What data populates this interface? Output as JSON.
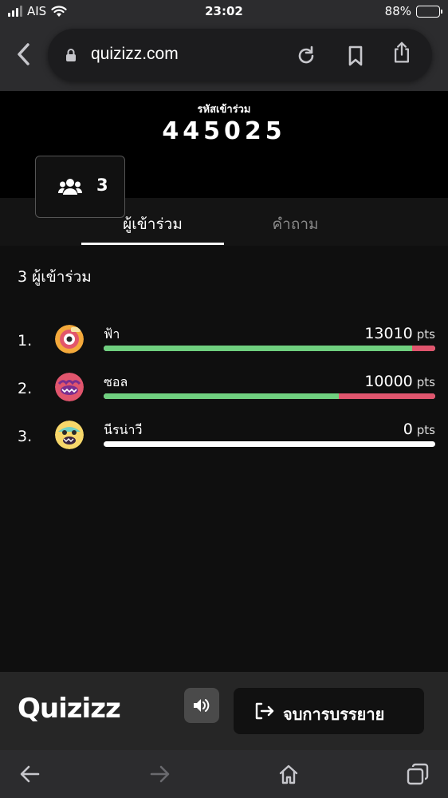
{
  "status": {
    "carrier": "AIS",
    "time": "23:02",
    "battery": "88%",
    "battery_level": 0.88
  },
  "browser": {
    "url": "quizizz.com"
  },
  "session": {
    "join_label": "รหัสเข้าร่วม",
    "join_code": "445025",
    "participant_count": "3"
  },
  "tabs": {
    "participants": "ผู้เข้าร่วม",
    "questions": "คำถาม"
  },
  "main": {
    "title": "3 ผู้เข้าร่วม"
  },
  "participants": [
    {
      "rank": "1.",
      "name": "ฟ้า",
      "score": "13010",
      "pts": "pts",
      "correct_fraction": 0.93
    },
    {
      "rank": "2.",
      "name": "ซอล",
      "score": "10000",
      "pts": "pts",
      "correct_fraction": 0.71
    },
    {
      "rank": "3.",
      "name": "นีรน่าวี",
      "score": "0",
      "pts": "pts",
      "correct_fraction": 0
    }
  ],
  "footer": {
    "logo": "Quizizz",
    "end_button": "จบการบรรยาย"
  },
  "colors": {
    "correct": "#6fcf7f",
    "incorrect": "#e0556d",
    "accent": "#ffffff"
  }
}
